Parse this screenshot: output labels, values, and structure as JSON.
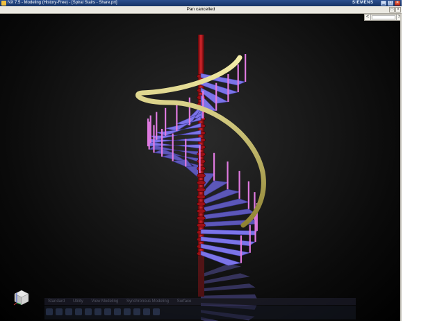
{
  "window": {
    "title": "NX 7.5 - Modeling (History-Free) - [Spiral Stairs - Share.prt]",
    "brand": "SIEMENS",
    "buttons": {
      "minimize": "_",
      "maximize": "□",
      "close": "×"
    }
  },
  "status_bar": {
    "message": "Pan cancelled"
  },
  "scroll": {
    "left": "<",
    "right": ">"
  },
  "reflected_toolbar": {
    "tabs": [
      "Standard",
      "Utility",
      "View Modeling",
      "Synchronous Modeling",
      "Surface"
    ]
  },
  "viewport": {
    "model": "spiral-staircase",
    "colors": {
      "background": "#000000",
      "pole": "#c4161c",
      "steps": "#7b74e8",
      "balusters": "#e07ae0",
      "handrail": "#d8cc62"
    }
  },
  "icons": [
    "app-icon",
    "minimize-icon",
    "maximize-icon",
    "close-icon",
    "scroll-left-icon",
    "scroll-right-icon",
    "view-triad-icon"
  ]
}
